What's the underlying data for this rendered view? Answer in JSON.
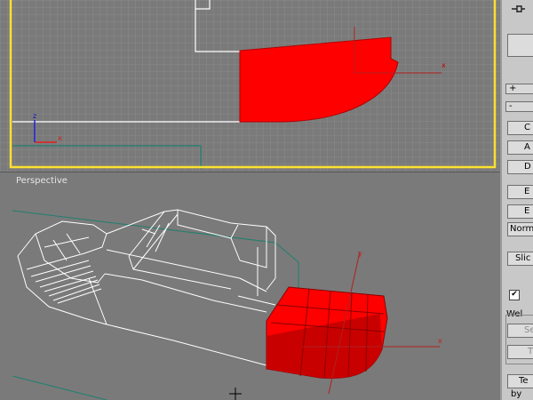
{
  "viewports": {
    "top": {
      "axis_x": "x",
      "axis_y": "z",
      "local_axis_x": "x"
    },
    "perspective": {
      "label": "Perspective",
      "axis_y": "y",
      "axis_x": "x"
    }
  },
  "colors": {
    "viewport_bg": "#7a7a7a",
    "grid": "#888888",
    "selected_object": "#ff0000",
    "active_border": "#ffeb3b"
  },
  "command_panel": {
    "buttons": [
      {
        "label": "C",
        "state": "normal"
      },
      {
        "label": "A",
        "state": "normal"
      },
      {
        "label": "D",
        "state": "normal"
      },
      {
        "label": "E",
        "state": "normal"
      },
      {
        "label": "E",
        "state": "normal"
      },
      {
        "label": "Norm",
        "state": "normal"
      },
      {
        "label": "Slic",
        "state": "normal"
      },
      {
        "label": "Se",
        "state": "disabled"
      },
      {
        "label": "T",
        "state": "disabled"
      },
      {
        "label": "Te",
        "state": "normal"
      }
    ],
    "rollouts": [
      {
        "sign": "+"
      },
      {
        "sign": "-"
      }
    ],
    "group_label": "Wel",
    "bottom_text": "by"
  }
}
